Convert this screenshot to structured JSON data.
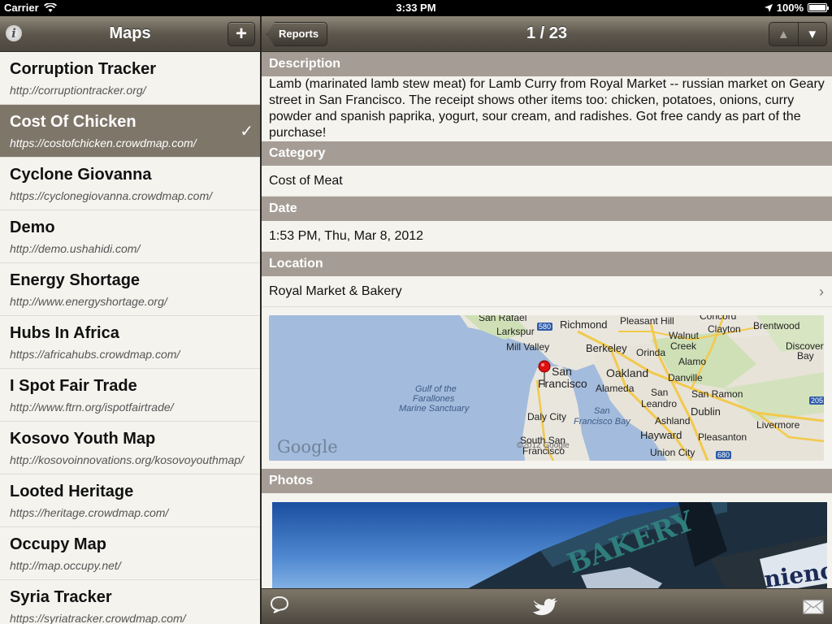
{
  "status": {
    "carrier": "Carrier",
    "time": "3:33 PM",
    "battery": "100%"
  },
  "master": {
    "title": "Maps",
    "info_icon": "info-icon",
    "add_label": "+",
    "items": [
      {
        "name": "Corruption Tracker",
        "url": "http://corruptiontracker.org/"
      },
      {
        "name": "Cost Of Chicken",
        "url": "https://costofchicken.crowdmap.com/",
        "selected": true
      },
      {
        "name": "Cyclone Giovanna",
        "url": "https://cyclonegiovanna.crowdmap.com/"
      },
      {
        "name": "Demo",
        "url": "http://demo.ushahidi.com/"
      },
      {
        "name": "Energy Shortage",
        "url": "http://www.energyshortage.org/"
      },
      {
        "name": "Hubs In Africa",
        "url": "https://africahubs.crowdmap.com/"
      },
      {
        "name": "I Spot Fair Trade",
        "url": "http://www.ftrn.org/ispotfairtrade/"
      },
      {
        "name": "Kosovo Youth Map",
        "url": "http://kosovoinnovations.org/kosovoyouthmap/"
      },
      {
        "name": "Looted Heritage",
        "url": "https://heritage.crowdmap.com/"
      },
      {
        "name": "Occupy Map",
        "url": "http://map.occupy.net/"
      },
      {
        "name": "Syria Tracker",
        "url": "https://syriatracker.crowdmap.com/"
      }
    ]
  },
  "detail": {
    "back_label": "Reports",
    "title": "1 / 23",
    "up_glyph": "▲",
    "down_glyph": "▼",
    "description_header": "Description",
    "description": "Lamb (marinated lamb stew meat) for Lamb Curry from Royal Market -- russian market on Geary street in San Francisco. The receipt shows other items too: chicken, potatoes, onions, curry powder and spanish paprika, yogurt, sour cream, and radishes. Got free candy as part of the purchase!",
    "category_header": "Category",
    "category": "Cost of Meat",
    "date_header": "Date",
    "date": "1:53 PM, Thu, Mar 8, 2012",
    "location_header": "Location",
    "location": "Royal Market & Bakery",
    "photos_header": "Photos",
    "map": {
      "provider": "Google",
      "copyright": "©2012 Google",
      "labels": {
        "san_rafael": "San Rafael",
        "richmond": "Richmond",
        "pleasant_hill": "Pleasant Hill",
        "concord": "Concord",
        "larkspur": "Larkspur",
        "walnut_creek_1": "Walnut",
        "walnut_creek_2": "Creek",
        "clayton": "Clayton",
        "brentwood": "Brentwood",
        "mill_valley": "Mill Valley",
        "berkeley": "Berkeley",
        "orinda": "Orinda",
        "discovery_1": "Discovery",
        "discovery_2": "Bay",
        "alamo": "Alamo",
        "san": "San",
        "francisco": "Francisco",
        "oakland": "Oakland",
        "danville": "Danville",
        "gulf_1": "Gulf of the",
        "gulf_2": "Farallones",
        "gulf_3": "Marine Sanctuary",
        "alameda": "Alameda",
        "san_leandro_1": "San",
        "san_leandro_2": "Leandro",
        "san_ramon": "San Ramon",
        "daly_city": "Daly City",
        "sf_bay_1": "San",
        "sf_bay_2": "Francisco Bay",
        "ashland": "Ashland",
        "dublin": "Dublin",
        "livermore": "Livermore",
        "south_san_1": "South San",
        "south_san_2": "Francisco",
        "hayward": "Hayward",
        "pleasanton": "Pleasanton",
        "union_city": "Union City",
        "i580": "580",
        "i205": "205",
        "i680": "680"
      }
    },
    "photo_sign": "BAKERY",
    "photo_sign_right": "nience"
  },
  "toolbar": {
    "comment_icon": "speech-bubble-icon",
    "twitter_icon": "twitter-bird-icon",
    "mail_icon": "mail-icon"
  }
}
